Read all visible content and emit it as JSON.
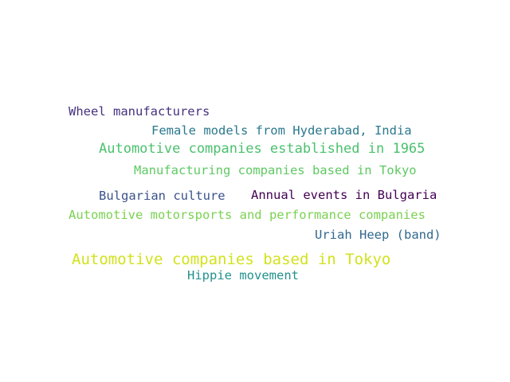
{
  "words": [
    {
      "text": "Wheel manufacturers",
      "color": "#46327e"
    },
    {
      "text": "Female models from Hyderabad, India",
      "color": "#2a788e"
    },
    {
      "text": "Automotive companies established in 1965",
      "color": "#4ac16d"
    },
    {
      "text": "Manufacturing companies based in Tokyo",
      "color": "#5ec962"
    },
    {
      "text": "Bulgarian culture",
      "color": "#3b528b"
    },
    {
      "text": "Annual events in Bulgaria",
      "color": "#440154"
    },
    {
      "text": "Automotive motorsports and performance companies",
      "color": "#7ad151"
    },
    {
      "text": "Uriah Heep (band)",
      "color": "#31688e"
    },
    {
      "text": "Automotive companies based in Tokyo",
      "color": "#d2e21b"
    },
    {
      "text": "Hippie movement",
      "color": "#21918c"
    }
  ]
}
